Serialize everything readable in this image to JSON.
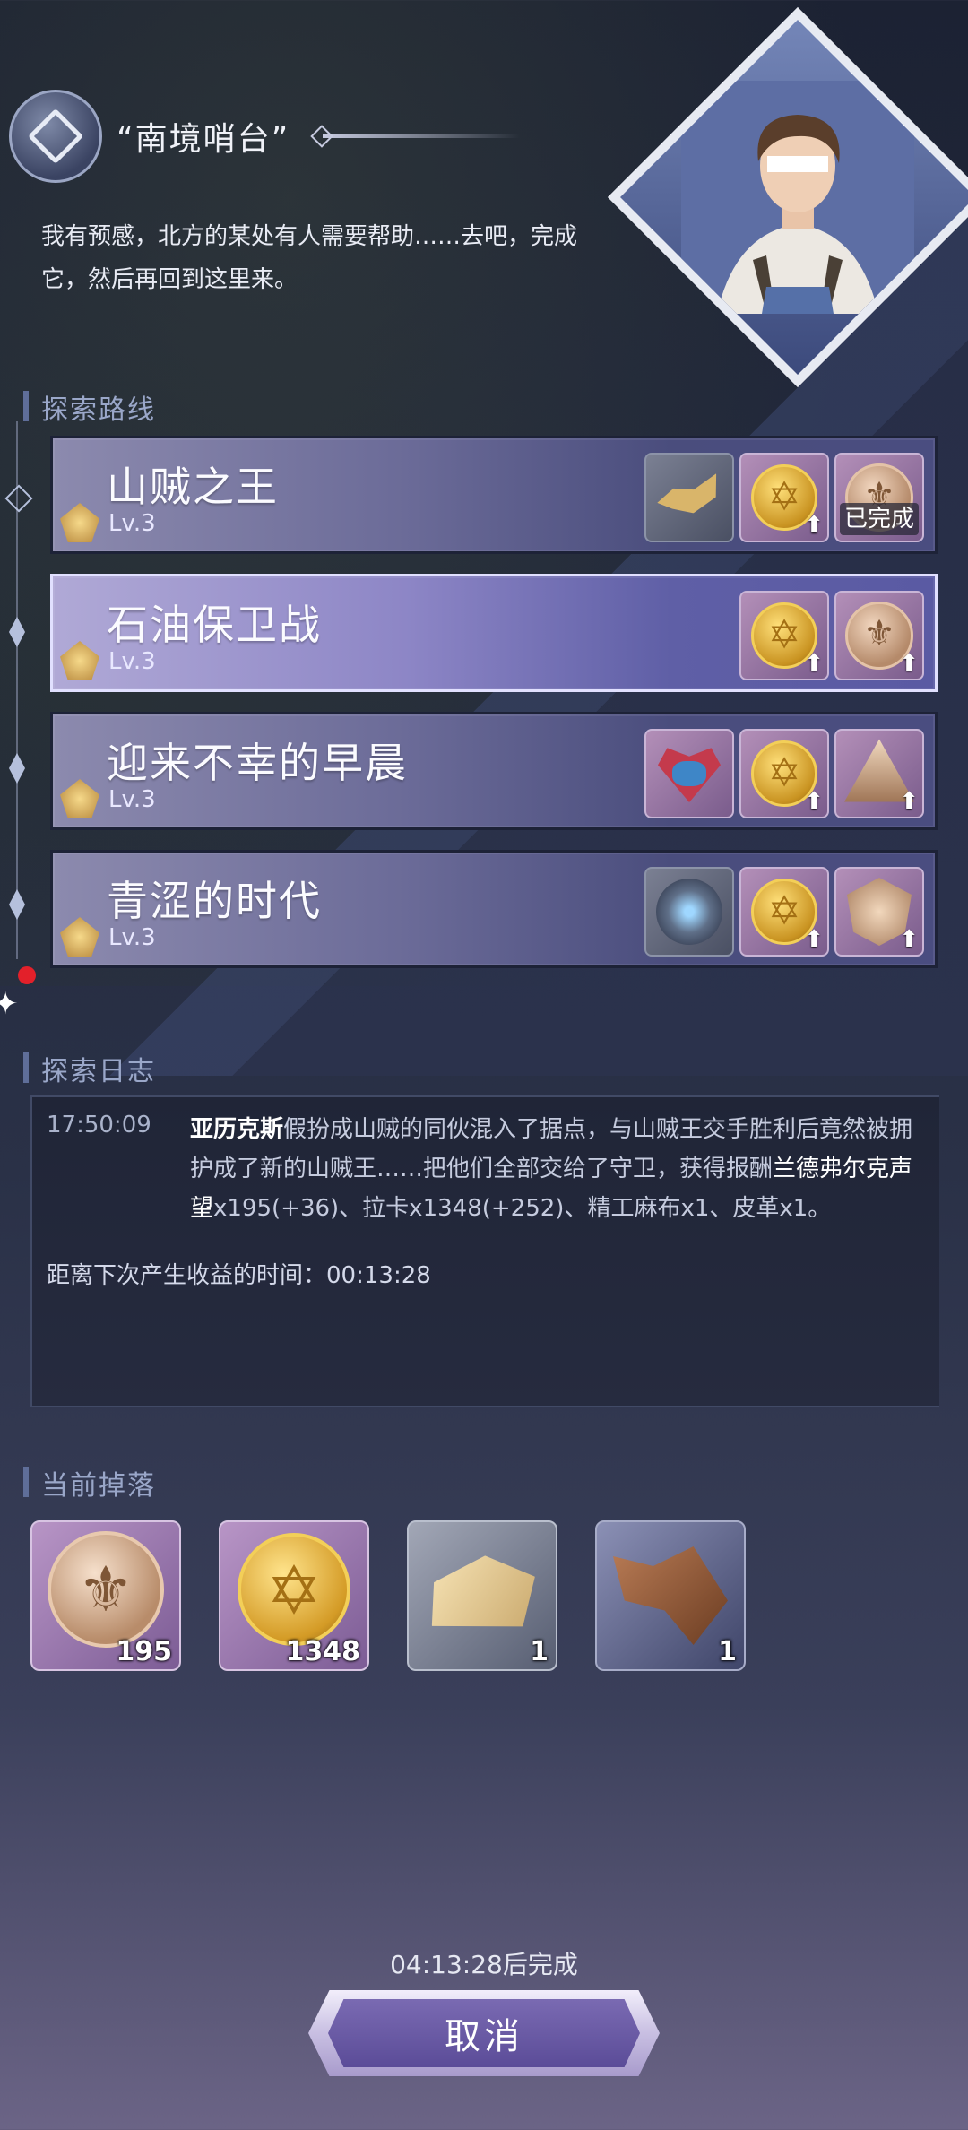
{
  "quest": {
    "title": "“南境哨台”",
    "description": "我有预感，北方的某处有人需要帮助……去吧，完成它，然后再回到这里来。"
  },
  "sections": {
    "routes": "探索路线",
    "log": "探索日志",
    "drops": "当前掉落"
  },
  "routes": [
    {
      "name": "山贼之王",
      "level": "Lv.3",
      "items": [
        "map-piece-icon",
        "coin-icon",
        "medal-icon"
      ],
      "done_label": "已完成"
    },
    {
      "name": "石油保卫战",
      "level": "Lv.3",
      "items": [
        "coin-icon",
        "medal-icon"
      ]
    },
    {
      "name": "迎来不幸的早晨",
      "level": "Lv.3",
      "items": [
        "heart-box-icon",
        "coin-icon",
        "triangle-emblem-icon"
      ]
    },
    {
      "name": "青涩的时代",
      "level": "Lv.3",
      "items": [
        "orb-icon",
        "coin-icon",
        "shield-emblem-icon"
      ]
    }
  ],
  "log": {
    "time": "17:50:09",
    "hero": "亚历克斯",
    "text_part1": "假扮成山贼的同伙混入了据点，与山贼王交手胜利后竟然被拥护成了新的山贼王……把他们全部交给了守卫，获得报酬",
    "reputation": "兰德弗尔克声望",
    "text_part2": "x195(+36)、拉卡x1348(+252)、精工麻布x1、皮革x1。",
    "next_label": "距离下次产生收益的时间：",
    "next_time": "00:13:28"
  },
  "drops": [
    {
      "icon": "medal-icon",
      "count": "195"
    },
    {
      "icon": "coin-icon",
      "count": "1348"
    },
    {
      "icon": "linen-icon",
      "count": "1"
    },
    {
      "icon": "leather-icon",
      "count": "1"
    }
  ],
  "footer": {
    "finish_text": "04:13:28后完成",
    "cancel_label": "取消"
  }
}
